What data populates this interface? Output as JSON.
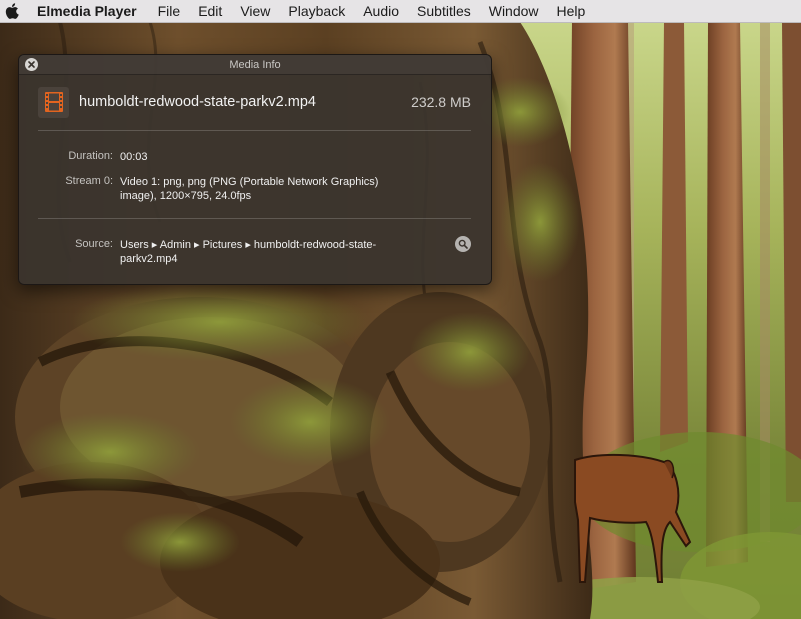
{
  "menubar": {
    "apple_icon": "apple-logo-icon",
    "app_name": "Elmedia Player",
    "items": [
      "File",
      "Edit",
      "View",
      "Playback",
      "Audio",
      "Subtitles",
      "Window",
      "Help"
    ]
  },
  "media_info": {
    "window_title": "Media Info",
    "close_icon": "close-icon",
    "file_icon": "film-strip-icon",
    "file_name": "humboldt-redwood-state-parkv2.mp4",
    "file_size": "232.8 MB",
    "duration_label": "Duration:",
    "duration_value": "00:03",
    "stream_label": "Stream 0:",
    "stream_value": "Video 1: png, png (PNG (Portable Network Graphics) image), 1200×795, 24.0fps",
    "source_label": "Source:",
    "source_value": "Users ▸ Admin ▸ Pictures ▸ humboldt-redwood-state-parkv2.mp4",
    "reveal_icon": "magnifier-icon"
  },
  "colors": {
    "menubar_bg": "#e6e4e6",
    "panel_bg": "#3a342e",
    "forest_green": "#7a8a3a",
    "bark_brown": "#5a3e22"
  }
}
